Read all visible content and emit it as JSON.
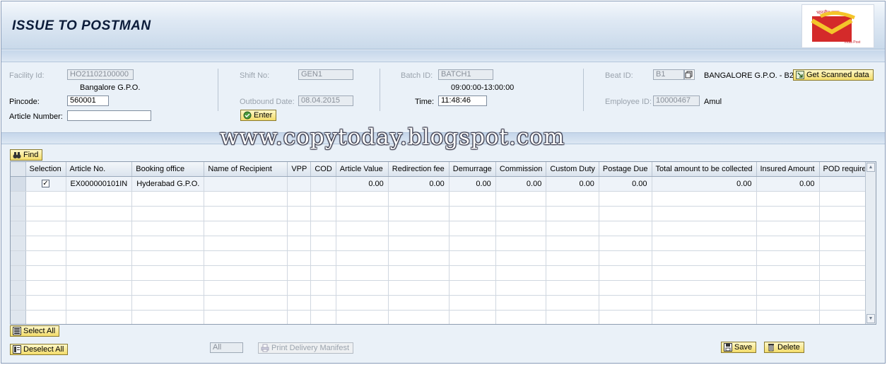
{
  "header": {
    "title": "ISSUE TO POSTMAN",
    "logo_text": "भारतीय डाक",
    "logo_sub": "India Post"
  },
  "form": {
    "facility_id_label": "Facility Id:",
    "facility_id_value": "HO21102100000",
    "facility_name": "Bangalore G.P.O.",
    "pincode_label": "Pincode:",
    "pincode_value": "560001",
    "article_number_label": "Article Number:",
    "article_number_value": "",
    "shift_no_label": "Shift No:",
    "shift_no_value": "GEN1",
    "outbound_date_label": "Outbound Date:",
    "outbound_date_value": "08.04.2015",
    "enter_label": "Enter",
    "batch_id_label": "Batch ID:",
    "batch_id_value": "BATCH1",
    "batch_time_range": "09:00:00-13:00:00",
    "time_label": "Time:",
    "time_value": "11:48:46",
    "beat_id_label": "Beat ID:",
    "beat_id_value": "B1",
    "beat_name": "BANGALORE G.P.O. - B2",
    "get_scanned_label": "Get Scanned data",
    "employee_id_label": "Employee ID:",
    "employee_id_value": "10000467",
    "employee_name": "Amul"
  },
  "watermark": "www.copytoday.blogspot.com",
  "toolbar": {
    "find_label": "Find"
  },
  "table": {
    "columns": [
      "Selection",
      "Article No.",
      "Booking office",
      "Name of Recipient",
      "VPP",
      "COD",
      "Article Value",
      "Redirection fee",
      "Demurrage",
      "Commission",
      "Custom Duty",
      "Postage Due",
      "Total amount to be collected",
      "Insured Amount",
      "POD required"
    ],
    "rows": [
      {
        "selected": true,
        "article_no": "EX000000101IN",
        "booking_office": "Hyderabad G.P.O.",
        "recipient": "",
        "vpp": "",
        "cod": "",
        "article_value": "0.00",
        "redirection_fee": "0.00",
        "demurrage": "0.00",
        "commission": "0.00",
        "custom_duty": "0.00",
        "postage_due": "0.00",
        "total_amount": "0.00",
        "insured_amount": "0.00",
        "pod_required": ""
      }
    ]
  },
  "footer": {
    "select_all_label": "Select All",
    "deselect_all_label": "Deselect All",
    "filter_value": "All",
    "print_manifest_label": "Print Delivery Manifest",
    "save_label": "Save",
    "delete_label": "Delete"
  }
}
